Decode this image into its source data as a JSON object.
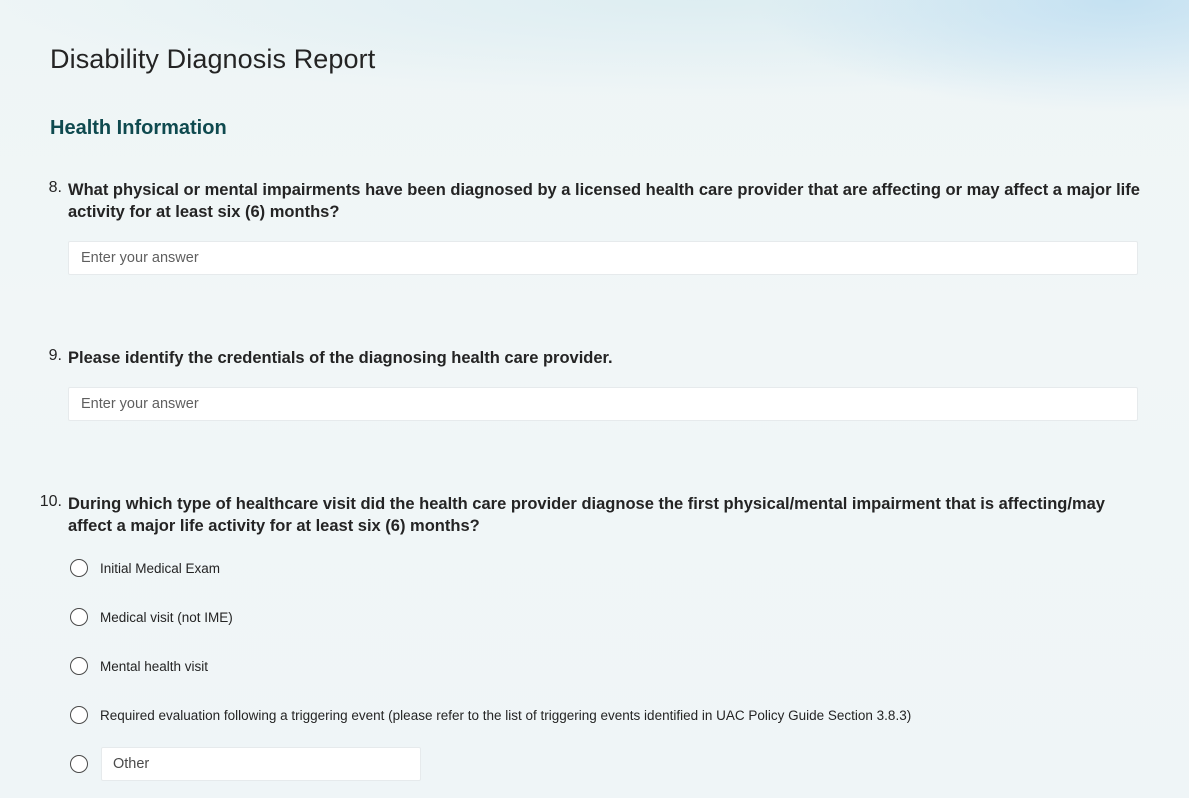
{
  "form": {
    "title": "Disability Diagnosis Report",
    "section_title": "Health Information"
  },
  "questions": [
    {
      "number": "8.",
      "text": "What physical or mental impairments have been diagnosed by a licensed health care provider that are affecting or may affect a major life activity for at least six (6) months?",
      "input_placeholder": "Enter your answer",
      "input_value": ""
    },
    {
      "number": "9.",
      "text": "Please identify the credentials of the diagnosing health care provider.",
      "input_placeholder": "Enter your answer",
      "input_value": ""
    },
    {
      "number": "10.",
      "text": "During which type of healthcare visit did the health care provider diagnose the first physical/mental impairment that is affecting/may affect a major life activity for at least six (6) months?",
      "options": [
        "Initial Medical Exam",
        "Medical visit (not IME)",
        "Mental health visit",
        "Required evaluation following a triggering event (please refer to the list of triggering events identified in UAC Policy Guide Section 3.8.3)"
      ],
      "other_placeholder": "Other"
    }
  ],
  "colors": {
    "section_title": "#0f4a4f",
    "text": "#242424",
    "input_background": "#ffffff"
  }
}
